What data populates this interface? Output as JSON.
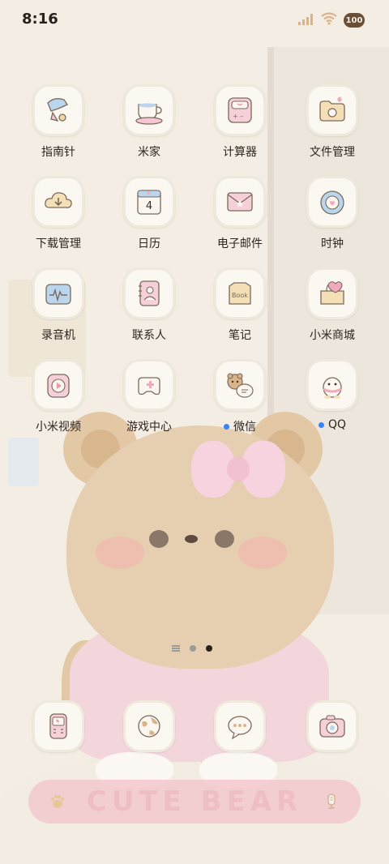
{
  "status_bar": {
    "time": "8:16",
    "battery": "100",
    "signal_icon": "signal-icon",
    "wifi_icon": "wifi-icon"
  },
  "apps": [
    {
      "label": "指南针",
      "icon": "compass-icon",
      "notify": false
    },
    {
      "label": "米家",
      "icon": "teacup-icon",
      "notify": false
    },
    {
      "label": "计算器",
      "icon": "calculator-icon",
      "notify": false
    },
    {
      "label": "文件管理",
      "icon": "folder-icon",
      "notify": false
    },
    {
      "label": "下载管理",
      "icon": "download-icon",
      "notify": false
    },
    {
      "label": "日历",
      "icon": "calendar-icon",
      "notify": false,
      "date": "4"
    },
    {
      "label": "电子邮件",
      "icon": "envelope-icon",
      "notify": false
    },
    {
      "label": "时钟",
      "icon": "clock-icon",
      "notify": false
    },
    {
      "label": "录音机",
      "icon": "recorder-icon",
      "notify": false
    },
    {
      "label": "联系人",
      "icon": "contacts-icon",
      "notify": false
    },
    {
      "label": "笔记",
      "icon": "notes-icon",
      "notify": false,
      "icon_text": "Book"
    },
    {
      "label": "小米商城",
      "icon": "shop-icon",
      "notify": false
    },
    {
      "label": "小米视频",
      "icon": "video-icon",
      "notify": false
    },
    {
      "label": "游戏中心",
      "icon": "gamepad-icon",
      "notify": false
    },
    {
      "label": "微信",
      "icon": "wechat-icon",
      "notify": true
    },
    {
      "label": "QQ",
      "icon": "qq-penguin-icon",
      "notify": true
    }
  ],
  "dock": [
    {
      "icon": "phone-icon"
    },
    {
      "icon": "globe-icon"
    },
    {
      "icon": "message-icon"
    },
    {
      "icon": "camera-icon"
    }
  ],
  "search_bar": {
    "text": "CUTE BEAR",
    "left_icon": "paw-icon",
    "right_icon": "mic-icon"
  },
  "colors": {
    "background": "#f4ede3",
    "icon_tile": "#fbf8f2",
    "notify_dot": "#3b82f6",
    "search_bar": "#f4c9cf"
  }
}
